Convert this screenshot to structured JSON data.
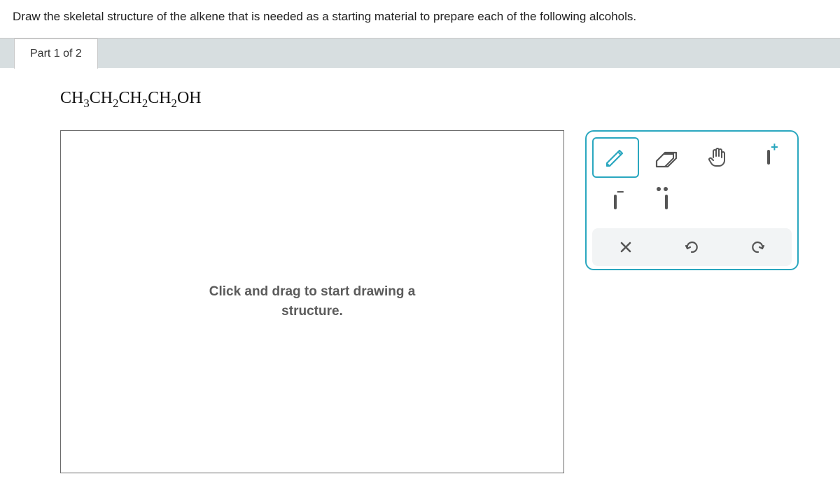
{
  "question": {
    "prompt": "Draw the skeletal structure of the alkene that is needed as a starting material to prepare each of the following alcohols."
  },
  "part": {
    "label": "Part 1 of 2"
  },
  "formula": {
    "html": "CH3CH2CH2CH2OH"
  },
  "canvas": {
    "placeholder_line1": "Click and drag to start drawing a",
    "placeholder_line2": "structure."
  },
  "tools": {
    "draw": "draw",
    "erase": "erase",
    "move": "move",
    "positive_charge": "positive-charge",
    "negative_charge": "negative-charge",
    "lone_pair": "lone-pair",
    "clear": "clear",
    "undo": "undo",
    "redo": "redo"
  },
  "colors": {
    "accent": "#2aa7bf",
    "icon": "#555"
  }
}
